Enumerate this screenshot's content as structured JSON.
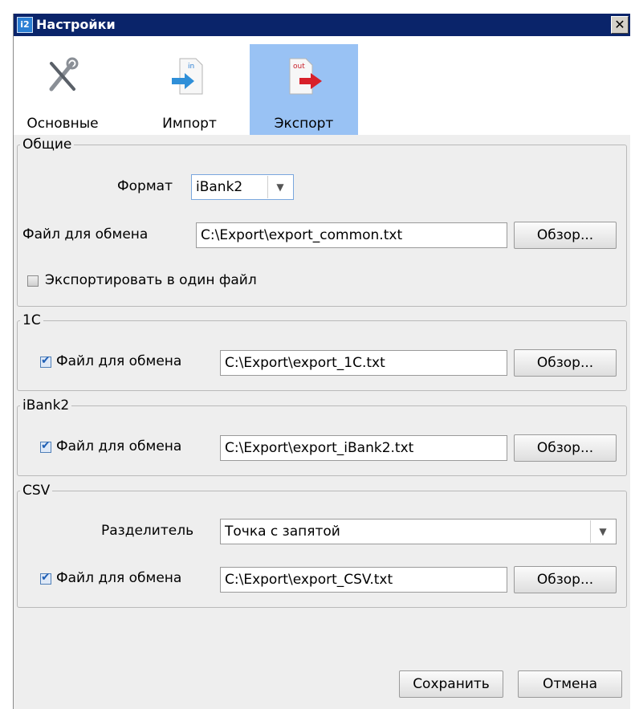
{
  "window": {
    "title": "Настройки",
    "app_icon": "i2",
    "close_glyph": "✕"
  },
  "tabs": [
    {
      "label": "Основные",
      "icon": "tools-icon",
      "active": false
    },
    {
      "label": "Импорт",
      "icon": "import-icon",
      "active": false
    },
    {
      "label": "Экспорт",
      "icon": "export-icon",
      "active": true
    }
  ],
  "common": {
    "legend": "Общие",
    "format_label": "Формат",
    "format_value": "iBank2",
    "file_label": "Файл для обмена",
    "file_value": "C:\\Export\\export_common.txt",
    "browse_label": "Обзор...",
    "single_file_label": "Экспортировать в один файл",
    "single_file_checked": false
  },
  "onec": {
    "legend": "1C",
    "file_label": "Файл для обмена",
    "file_value": "C:\\Export\\export_1C.txt",
    "browse_label": "Обзор...",
    "checked": true
  },
  "ibank2": {
    "legend": "iBank2",
    "file_label": "Файл для обмена",
    "file_value": "C:\\Export\\export_iBank2.txt",
    "browse_label": "Обзор...",
    "checked": true
  },
  "csv": {
    "legend": "CSV",
    "separator_label": "Разделитель",
    "separator_value": "Точка с запятой",
    "file_label": "Файл для обмена",
    "file_value": "C:\\Export\\export_CSV.txt",
    "browse_label": "Обзор...",
    "checked": true
  },
  "footer": {
    "save_label": "Сохранить",
    "cancel_label": "Отмена"
  },
  "colors": {
    "titlebar": "#0a246a",
    "active_tab": "#99c2f4",
    "panel": "#eeeeee"
  }
}
